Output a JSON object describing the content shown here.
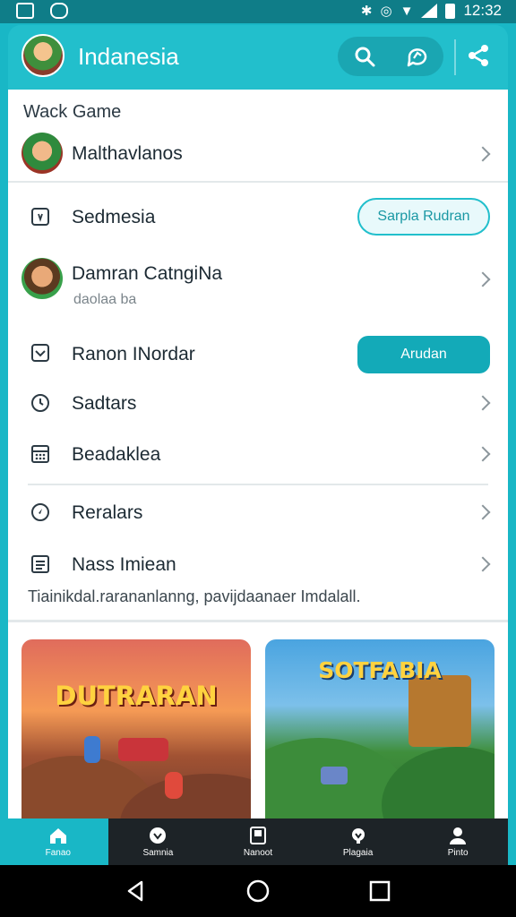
{
  "status_bar": {
    "time": "12:32"
  },
  "app_bar": {
    "title": "Indanesia",
    "search_icon": "search-icon",
    "chat_icon": "chat-icon",
    "share_icon": "share-icon"
  },
  "section": {
    "title": "Wack Game"
  },
  "rows": [
    {
      "label": "Malthavlanos",
      "icon": "avatar"
    },
    {
      "label": "Sedmesia",
      "icon": "square-icon",
      "button": "Sarpla Rudran"
    },
    {
      "label": "Damran CatngiNa",
      "sublabel": "daolaa ba",
      "icon": "avatar"
    },
    {
      "label": "Ranon INordar",
      "icon": "inbox-icon",
      "button": "Arudan"
    },
    {
      "label": "Sadtars",
      "icon": "clock-icon"
    },
    {
      "label": "Beadaklea",
      "icon": "grid-icon"
    },
    {
      "label": "Reralars",
      "icon": "compass-icon"
    },
    {
      "label": "Nass Imiean",
      "icon": "list-icon"
    }
  ],
  "footer_note": "Tiainikdal.rarananlanng, pavijdaanaer Imdalall.",
  "cards": [
    {
      "title": "DUTRARAN"
    },
    {
      "title": "SOTFABIA"
    }
  ],
  "bottom_nav": [
    {
      "label": "Fanao",
      "icon": "home-icon",
      "active": true
    },
    {
      "label": "Samnia",
      "icon": "heart-badge-icon",
      "active": false
    },
    {
      "label": "Nanoot",
      "icon": "bookmark-icon",
      "active": false
    },
    {
      "label": "Plagaia",
      "icon": "gear-heart-icon",
      "active": false
    },
    {
      "label": "Pinto",
      "icon": "person-icon",
      "active": false
    }
  ],
  "colors": {
    "accent": "#19b7c6",
    "accent_dark": "#0f7d88",
    "nav_bg": "#1d2327"
  }
}
